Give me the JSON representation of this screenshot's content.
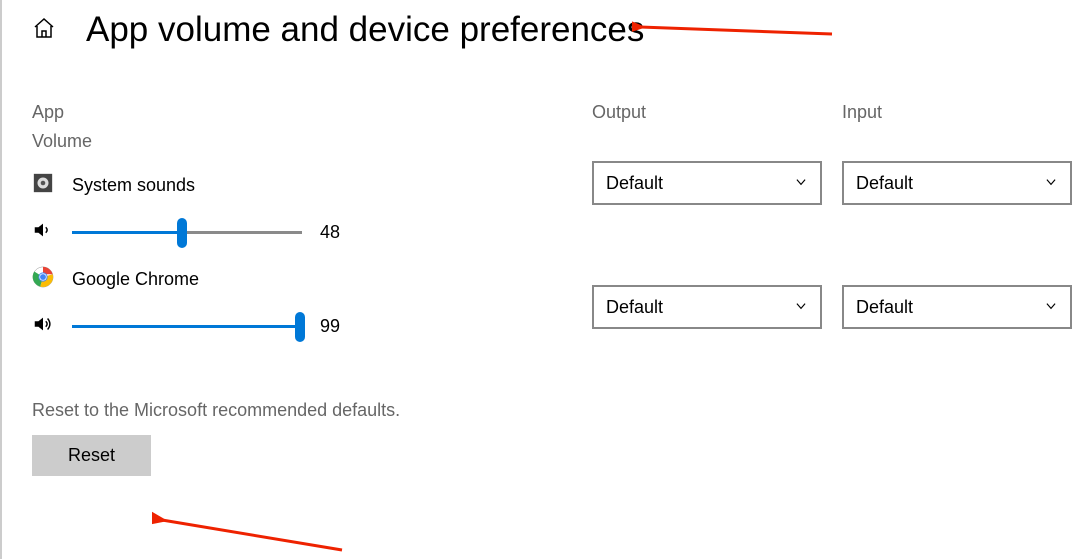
{
  "header": {
    "title": "App volume and device preferences"
  },
  "columns": {
    "app": "App",
    "volume": "Volume",
    "output": "Output",
    "input": "Input"
  },
  "apps": [
    {
      "name": "System sounds",
      "volume": 48,
      "output": "Default",
      "input": "Default"
    },
    {
      "name": "Google Chrome",
      "volume": 99,
      "output": "Default",
      "input": "Default"
    }
  ],
  "reset": {
    "description": "Reset to the Microsoft recommended defaults.",
    "button": "Reset"
  }
}
